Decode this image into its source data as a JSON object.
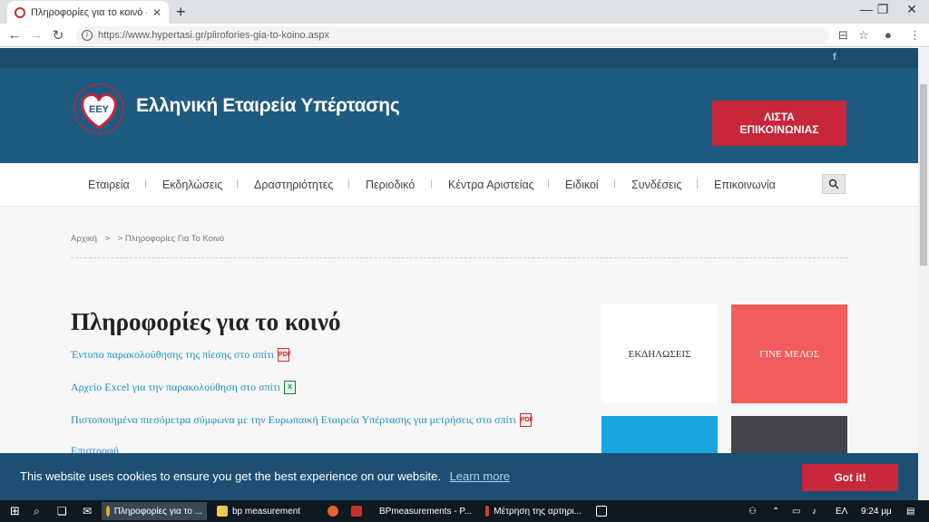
{
  "browser": {
    "tab_title": "Πληροφορίες για το κοινό - Πλη",
    "tab_close": "✕",
    "new_tab": "+",
    "url": "https://www.hypertasi.gr/plirofories-gia-to-koino.aspx",
    "window_controls": [
      "—",
      "❐",
      "✕"
    ]
  },
  "site": {
    "facebook": "f",
    "brand_name": "Ελληνική  Εταιρεία Υπέρτασης",
    "logo_text": "EEY",
    "cta_line1": "ΛΙΣΤΑ",
    "cta_line2": "ΕΠΙΚΟΙΝΩΝΙΑΣ",
    "nav": [
      "Εταιρεία",
      "Εκδηλώσεις",
      "Δραστηριότητες",
      "Περιοδικό",
      "Κέντρα Αριστείας",
      "Ειδικοί",
      "Συνδέσεις",
      "Επικοινωνία"
    ],
    "breadcrumb_home": "Αρχική",
    "breadcrumb_sep": ">",
    "breadcrumb_current": "> Πληροφορίες Για Το Κοινό",
    "page_title": "Πληροφορίες για το κοινό",
    "links": [
      {
        "text": "Έντυπο παρακολούθησης της πίεσης στο σπίτι",
        "icon": "pdf-icon"
      },
      {
        "text": "Αρχείο Excel για την παρακολούθηση στο σπίτι",
        "icon": "excel-icon"
      },
      {
        "text": "Πιστοποιημένα πιεσόμετρα σύμφωνα με την Ευρωπαική Εταιρεία Υπέρτασης για μετρήσεις στο σπίτι",
        "icon": "pdf-icon"
      },
      {
        "text": "Επιστροφή",
        "icon": ""
      }
    ],
    "boxes": [
      {
        "label": "ΕΚΔΗΛΩΣΕΙΣ",
        "color": "#ffffff"
      },
      {
        "label": "ΓΙΝΕ ΜΕΛΟΣ",
        "color": "#f25c5c"
      },
      {
        "label": "",
        "color": "#1aa6dc"
      },
      {
        "label": "",
        "color": "#444448"
      }
    ]
  },
  "cookie": {
    "message": "This website uses cookies to ensure you get the best experience on our website.",
    "learn_more": "Learn more",
    "button": "Got it!"
  },
  "taskbar": {
    "items": [
      "Πληροφορίες για το ...",
      "bp measurement",
      "BPmeasurements - P...",
      "Μέτρηση της αρτηρι..."
    ],
    "language": "ΕΛ",
    "time": "9:24 μμ"
  }
}
